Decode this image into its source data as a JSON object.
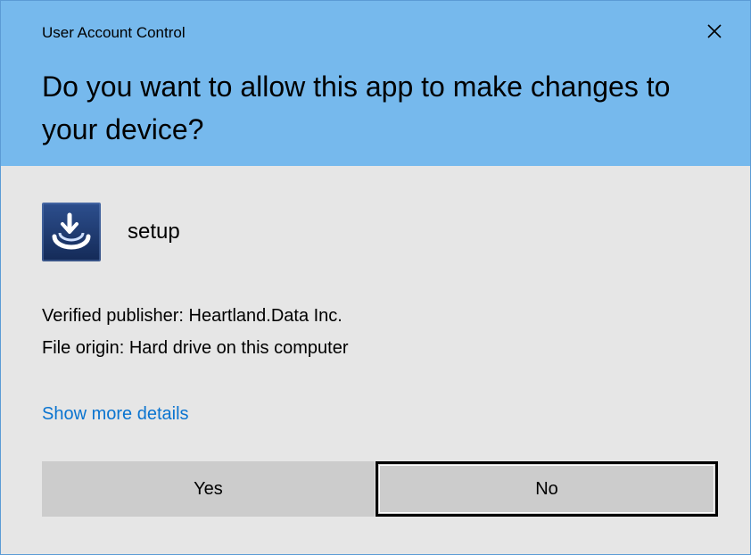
{
  "window": {
    "caption": "User Account Control",
    "close_icon": "close-icon"
  },
  "prompt": {
    "title": "Do you want to allow this app to make changes to your device?"
  },
  "app": {
    "icon": "setup-installer-icon",
    "name": "setup"
  },
  "info": {
    "publisher": "Verified publisher: Heartland.Data Inc.",
    "origin": "File origin: Hard drive on this computer"
  },
  "details_link": "Show more details",
  "buttons": {
    "yes": "Yes",
    "no": "No"
  },
  "colors": {
    "header": "#76b9ed",
    "body": "#e6e6e6",
    "link": "#0a74d0",
    "button": "#cccccc",
    "icon_bg": "#1f3b73"
  }
}
